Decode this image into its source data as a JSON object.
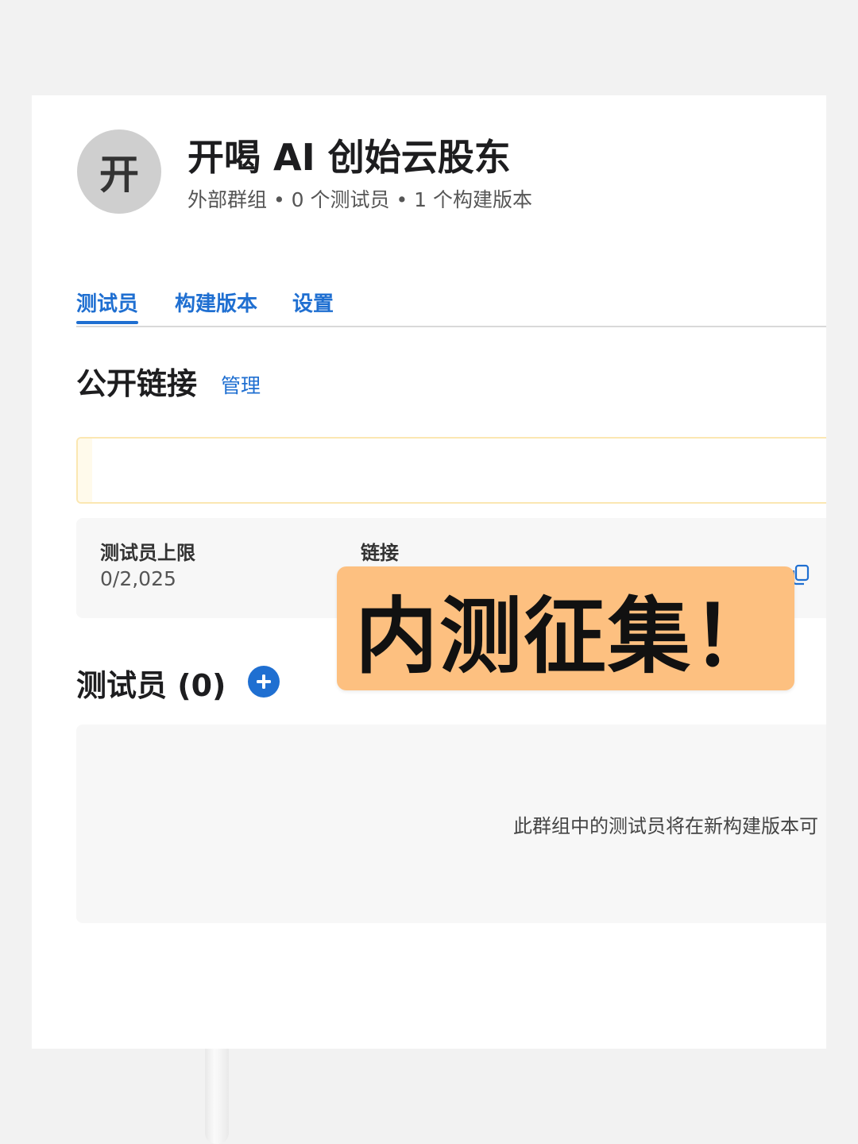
{
  "group": {
    "avatar_letter": "开",
    "title": "开喝 AI 创始云股东",
    "meta": "外部群组 • 0 个测试员 • 1 个构建版本"
  },
  "tabs": [
    {
      "label": "测试员",
      "active": true
    },
    {
      "label": "构建版本",
      "active": false
    },
    {
      "label": "设置",
      "active": false
    }
  ],
  "public_link": {
    "title": "公开链接",
    "manage_label": "管理",
    "tester_limit_label": "测试员上限",
    "tester_limit_value": "0/2,025",
    "link_label": "链接"
  },
  "testers": {
    "title": "测试员 (0)",
    "empty_text": "此群组中的测试员将在新构建版本可"
  },
  "overlay": {
    "banner_text": "内测征集！"
  },
  "colors": {
    "accent": "#1f6fd1",
    "banner": "#fdc080",
    "background": "#f2f2f2"
  }
}
